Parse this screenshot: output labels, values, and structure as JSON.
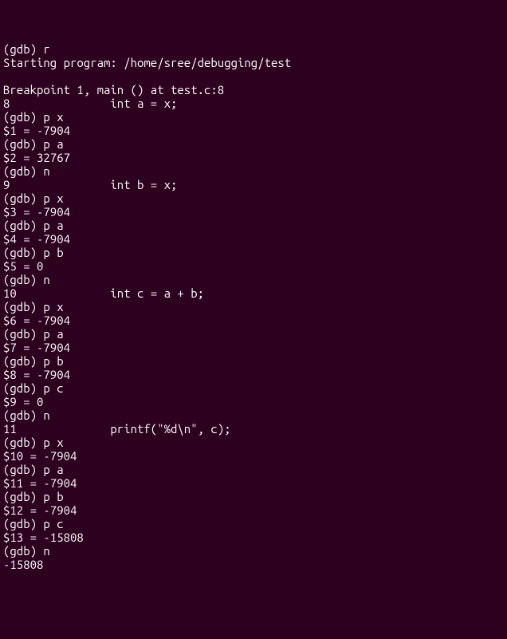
{
  "lines": [
    "(gdb) r",
    "Starting program: /home/sree/debugging/test",
    "",
    "Breakpoint 1, main () at test.c:8",
    "8               int a = x;",
    "(gdb) p x",
    "$1 = -7904",
    "(gdb) p a",
    "$2 = 32767",
    "(gdb) n",
    "9               int b = x;",
    "(gdb) p x",
    "$3 = -7904",
    "(gdb) p a",
    "$4 = -7904",
    "(gdb) p b",
    "$5 = 0",
    "(gdb) n",
    "10              int c = a + b;",
    "(gdb) p x",
    "$6 = -7904",
    "(gdb) p a",
    "$7 = -7904",
    "(gdb) p b",
    "$8 = -7904",
    "(gdb) p c",
    "$9 = 0",
    "(gdb) n",
    "11              printf(\"%d\\n\", c);",
    "(gdb) p x",
    "$10 = -7904",
    "(gdb) p a",
    "$11 = -7904",
    "(gdb) p b",
    "$12 = -7904",
    "(gdb) p c",
    "$13 = -15808",
    "(gdb) n",
    "-15808"
  ]
}
